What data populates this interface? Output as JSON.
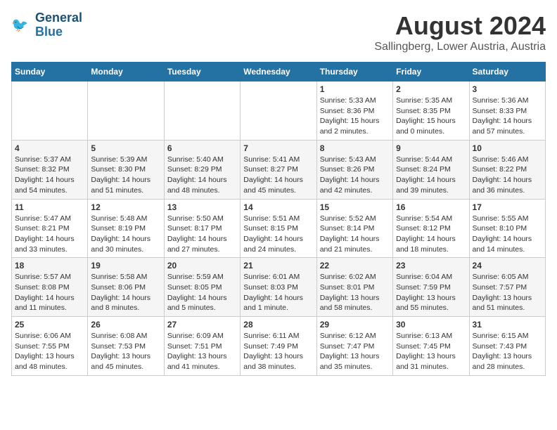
{
  "header": {
    "logo_line1": "General",
    "logo_line2": "Blue",
    "month_year": "August 2024",
    "location": "Sallingberg, Lower Austria, Austria"
  },
  "weekdays": [
    "Sunday",
    "Monday",
    "Tuesday",
    "Wednesday",
    "Thursday",
    "Friday",
    "Saturday"
  ],
  "weeks": [
    [
      {
        "day": "",
        "info": ""
      },
      {
        "day": "",
        "info": ""
      },
      {
        "day": "",
        "info": ""
      },
      {
        "day": "",
        "info": ""
      },
      {
        "day": "1",
        "info": "Sunrise: 5:33 AM\nSunset: 8:36 PM\nDaylight: 15 hours\nand 2 minutes."
      },
      {
        "day": "2",
        "info": "Sunrise: 5:35 AM\nSunset: 8:35 PM\nDaylight: 15 hours\nand 0 minutes."
      },
      {
        "day": "3",
        "info": "Sunrise: 5:36 AM\nSunset: 8:33 PM\nDaylight: 14 hours\nand 57 minutes."
      }
    ],
    [
      {
        "day": "4",
        "info": "Sunrise: 5:37 AM\nSunset: 8:32 PM\nDaylight: 14 hours\nand 54 minutes."
      },
      {
        "day": "5",
        "info": "Sunrise: 5:39 AM\nSunset: 8:30 PM\nDaylight: 14 hours\nand 51 minutes."
      },
      {
        "day": "6",
        "info": "Sunrise: 5:40 AM\nSunset: 8:29 PM\nDaylight: 14 hours\nand 48 minutes."
      },
      {
        "day": "7",
        "info": "Sunrise: 5:41 AM\nSunset: 8:27 PM\nDaylight: 14 hours\nand 45 minutes."
      },
      {
        "day": "8",
        "info": "Sunrise: 5:43 AM\nSunset: 8:26 PM\nDaylight: 14 hours\nand 42 minutes."
      },
      {
        "day": "9",
        "info": "Sunrise: 5:44 AM\nSunset: 8:24 PM\nDaylight: 14 hours\nand 39 minutes."
      },
      {
        "day": "10",
        "info": "Sunrise: 5:46 AM\nSunset: 8:22 PM\nDaylight: 14 hours\nand 36 minutes."
      }
    ],
    [
      {
        "day": "11",
        "info": "Sunrise: 5:47 AM\nSunset: 8:21 PM\nDaylight: 14 hours\nand 33 minutes."
      },
      {
        "day": "12",
        "info": "Sunrise: 5:48 AM\nSunset: 8:19 PM\nDaylight: 14 hours\nand 30 minutes."
      },
      {
        "day": "13",
        "info": "Sunrise: 5:50 AM\nSunset: 8:17 PM\nDaylight: 14 hours\nand 27 minutes."
      },
      {
        "day": "14",
        "info": "Sunrise: 5:51 AM\nSunset: 8:15 PM\nDaylight: 14 hours\nand 24 minutes."
      },
      {
        "day": "15",
        "info": "Sunrise: 5:52 AM\nSunset: 8:14 PM\nDaylight: 14 hours\nand 21 minutes."
      },
      {
        "day": "16",
        "info": "Sunrise: 5:54 AM\nSunset: 8:12 PM\nDaylight: 14 hours\nand 18 minutes."
      },
      {
        "day": "17",
        "info": "Sunrise: 5:55 AM\nSunset: 8:10 PM\nDaylight: 14 hours\nand 14 minutes."
      }
    ],
    [
      {
        "day": "18",
        "info": "Sunrise: 5:57 AM\nSunset: 8:08 PM\nDaylight: 14 hours\nand 11 minutes."
      },
      {
        "day": "19",
        "info": "Sunrise: 5:58 AM\nSunset: 8:06 PM\nDaylight: 14 hours\nand 8 minutes."
      },
      {
        "day": "20",
        "info": "Sunrise: 5:59 AM\nSunset: 8:05 PM\nDaylight: 14 hours\nand 5 minutes."
      },
      {
        "day": "21",
        "info": "Sunrise: 6:01 AM\nSunset: 8:03 PM\nDaylight: 14 hours\nand 1 minute."
      },
      {
        "day": "22",
        "info": "Sunrise: 6:02 AM\nSunset: 8:01 PM\nDaylight: 13 hours\nand 58 minutes."
      },
      {
        "day": "23",
        "info": "Sunrise: 6:04 AM\nSunset: 7:59 PM\nDaylight: 13 hours\nand 55 minutes."
      },
      {
        "day": "24",
        "info": "Sunrise: 6:05 AM\nSunset: 7:57 PM\nDaylight: 13 hours\nand 51 minutes."
      }
    ],
    [
      {
        "day": "25",
        "info": "Sunrise: 6:06 AM\nSunset: 7:55 PM\nDaylight: 13 hours\nand 48 minutes."
      },
      {
        "day": "26",
        "info": "Sunrise: 6:08 AM\nSunset: 7:53 PM\nDaylight: 13 hours\nand 45 minutes."
      },
      {
        "day": "27",
        "info": "Sunrise: 6:09 AM\nSunset: 7:51 PM\nDaylight: 13 hours\nand 41 minutes."
      },
      {
        "day": "28",
        "info": "Sunrise: 6:11 AM\nSunset: 7:49 PM\nDaylight: 13 hours\nand 38 minutes."
      },
      {
        "day": "29",
        "info": "Sunrise: 6:12 AM\nSunset: 7:47 PM\nDaylight: 13 hours\nand 35 minutes."
      },
      {
        "day": "30",
        "info": "Sunrise: 6:13 AM\nSunset: 7:45 PM\nDaylight: 13 hours\nand 31 minutes."
      },
      {
        "day": "31",
        "info": "Sunrise: 6:15 AM\nSunset: 7:43 PM\nDaylight: 13 hours\nand 28 minutes."
      }
    ]
  ]
}
